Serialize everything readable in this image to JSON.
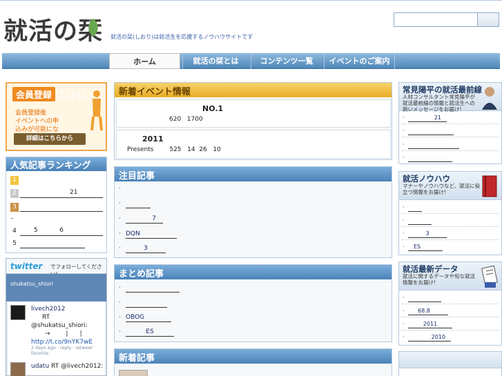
{
  "header": {
    "logo": "就活の栞",
    "tagline": "就活の栞(しおり)は就活生を応援するノウハウサイトです",
    "search_placeholder": ""
  },
  "nav": {
    "items": [
      "ホーム",
      "就活の栞とは",
      "コンテンツ一覧",
      "イベントのご案内"
    ]
  },
  "register": {
    "title": "会員登録",
    "text": "会員登録後\nイベントへの申込みが可能になります。",
    "button": "詳細はこちらから"
  },
  "ranking": {
    "title": "人気記事ランキング",
    "items": [
      {
        "num": "1",
        "text": ""
      },
      {
        "num": "2",
        "text": "21"
      },
      {
        "num": "3",
        "text": ""
      },
      {
        "num": "",
        "text": "–"
      },
      {
        "num": "4",
        "text": "5           6"
      },
      {
        "num": "5",
        "text": ""
      }
    ]
  },
  "twitter": {
    "logo": "twitter",
    "follow": "でフォローしてください!",
    "user": "shukatsu_shiori",
    "tweets": [
      {
        "author": "livech2012",
        "body": "RT @shukatsu_shiori:",
        "body2": "→        |      |",
        "link": "http://t.co/9nYK7wE",
        "meta": "2 days ago · reply · retweet ·",
        "meta2": "favorite"
      },
      {
        "author": "udatu",
        "body": "RT @livech2012:"
      }
    ]
  },
  "events": {
    "title": "新着イベント情報",
    "items": [
      {
        "headline": "NO.1",
        "detail": "620   1700"
      },
      {
        "headline": "2011",
        "detail": "Presents        525   14  26   10"
      }
    ]
  },
  "featured": {
    "title": "注目記事",
    "items": [
      "",
      "",
      "7",
      "DQN",
      "3"
    ]
  },
  "summary": {
    "title": "まとめ記事",
    "items": [
      "",
      "",
      "OBOG",
      "ES"
    ]
  },
  "new_articles": {
    "title": "新着記事"
  },
  "right_boxes": [
    {
      "title": "常見陽平の就活最前線",
      "desc": "人材コンサルタント常見陽平が就活最前線の情報と就活生への熱いメッセージをお届け!",
      "items": [
        "21",
        "",
        "",
        ""
      ]
    },
    {
      "title": "就活ノウハウ",
      "desc": "マナーやノウハウなど、就活に役立つ情報をお届け!",
      "items": [
        "",
        "",
        "3",
        "ES"
      ]
    },
    {
      "title": "就活最新データ",
      "desc": "就活に関するデータや旬な就活情報をお届け!",
      "items": [
        "",
        "68.8",
        "2011",
        "2010"
      ]
    }
  ],
  "colors": {
    "nav_blue": "#4f87ba",
    "event_yellow": "#e9ac24",
    "register_orange": "#ef8a1f",
    "link": "#1a2a6a"
  }
}
